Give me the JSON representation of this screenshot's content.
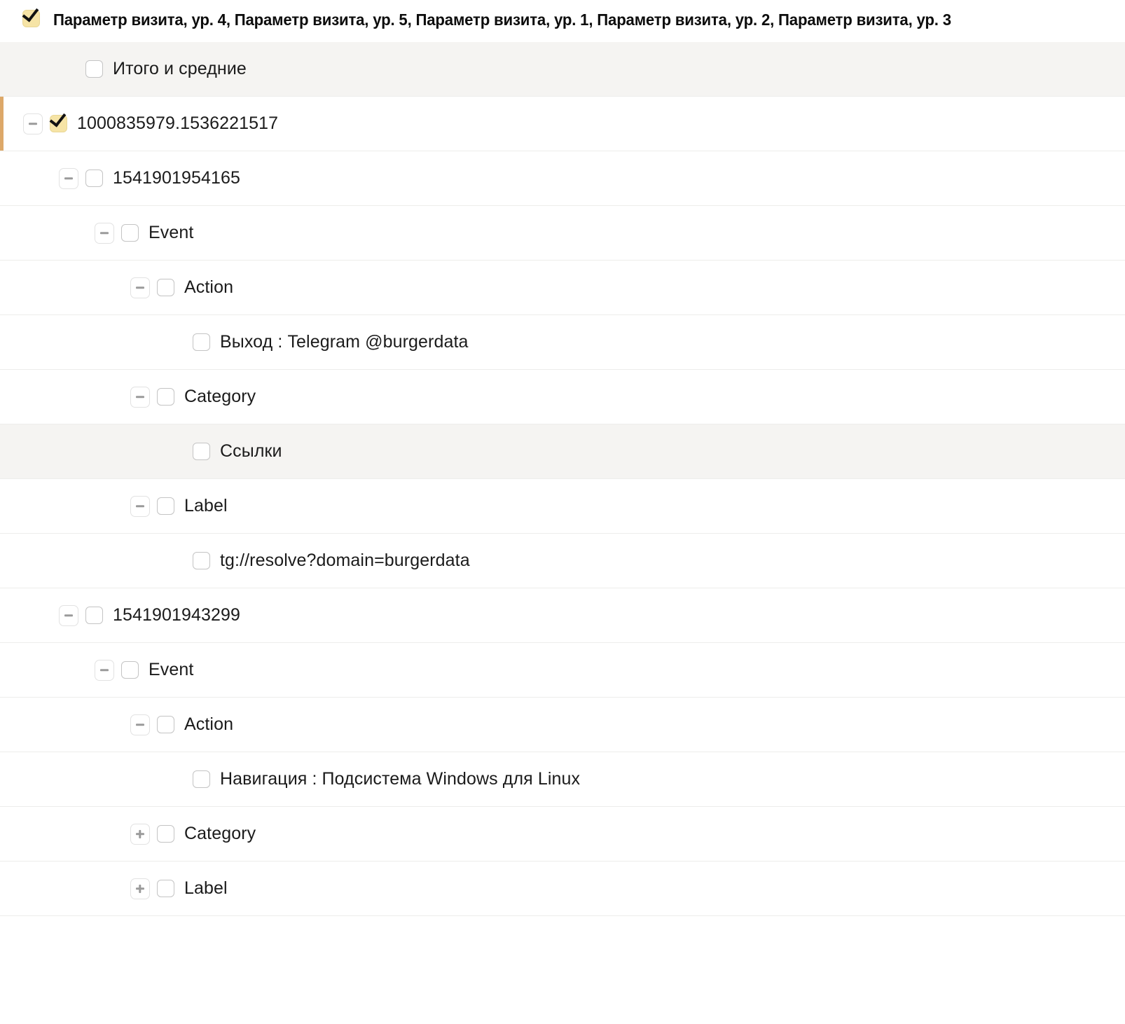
{
  "header": {
    "checkbox_state": "checked",
    "checkbox_color": "#f6e4a6",
    "label": "Параметр визита, ур. 4, Параметр визита, ур. 5, Параметр визита, ур. 1, Параметр визита, ур. 2, Параметр визита, ур. 3"
  },
  "accent": {
    "selected_row_border": "#dda869",
    "shaded_row_background": "#f5f4f2",
    "row_separator": "#ededeb"
  },
  "tree": {
    "rows": [
      {
        "label": "Итого и средние",
        "depth": 1,
        "expander": "none",
        "checkbox": "unchecked",
        "shaded": true,
        "selected": false
      },
      {
        "label": "1000835979.1536221517",
        "depth": 0,
        "expander": "minus",
        "checkbox": "checked",
        "shaded": false,
        "selected": true
      },
      {
        "label": "1541901954165",
        "depth": 1,
        "expander": "minus",
        "checkbox": "unchecked",
        "shaded": false,
        "selected": false
      },
      {
        "label": "Event",
        "depth": 2,
        "expander": "minus",
        "checkbox": "unchecked",
        "shaded": false,
        "selected": false
      },
      {
        "label": "Action",
        "depth": 3,
        "expander": "minus",
        "checkbox": "unchecked",
        "shaded": false,
        "selected": false
      },
      {
        "label": "Выход : Telegram @burgerdata",
        "depth": 4,
        "expander": "none",
        "checkbox": "unchecked",
        "shaded": false,
        "selected": false
      },
      {
        "label": "Category",
        "depth": 3,
        "expander": "minus",
        "checkbox": "unchecked",
        "shaded": false,
        "selected": false
      },
      {
        "label": "Ссылки",
        "depth": 4,
        "expander": "none",
        "checkbox": "unchecked",
        "shaded": true,
        "selected": false
      },
      {
        "label": "Label",
        "depth": 3,
        "expander": "minus",
        "checkbox": "unchecked",
        "shaded": false,
        "selected": false
      },
      {
        "label": "tg://resolve?domain=burgerdata",
        "depth": 4,
        "expander": "none",
        "checkbox": "unchecked",
        "shaded": false,
        "selected": false
      },
      {
        "label": "1541901943299",
        "depth": 1,
        "expander": "minus",
        "checkbox": "unchecked",
        "shaded": false,
        "selected": false
      },
      {
        "label": "Event",
        "depth": 2,
        "expander": "minus",
        "checkbox": "unchecked",
        "shaded": false,
        "selected": false
      },
      {
        "label": "Action",
        "depth": 3,
        "expander": "minus",
        "checkbox": "unchecked",
        "shaded": false,
        "selected": false
      },
      {
        "label": "Навигация : Подсистема Windows для Linux",
        "depth": 4,
        "expander": "none",
        "checkbox": "unchecked",
        "shaded": false,
        "selected": false
      },
      {
        "label": "Category",
        "depth": 3,
        "expander": "plus",
        "checkbox": "unchecked",
        "shaded": false,
        "selected": false
      },
      {
        "label": "Label",
        "depth": 3,
        "expander": "plus",
        "checkbox": "unchecked",
        "shaded": false,
        "selected": false
      }
    ]
  }
}
